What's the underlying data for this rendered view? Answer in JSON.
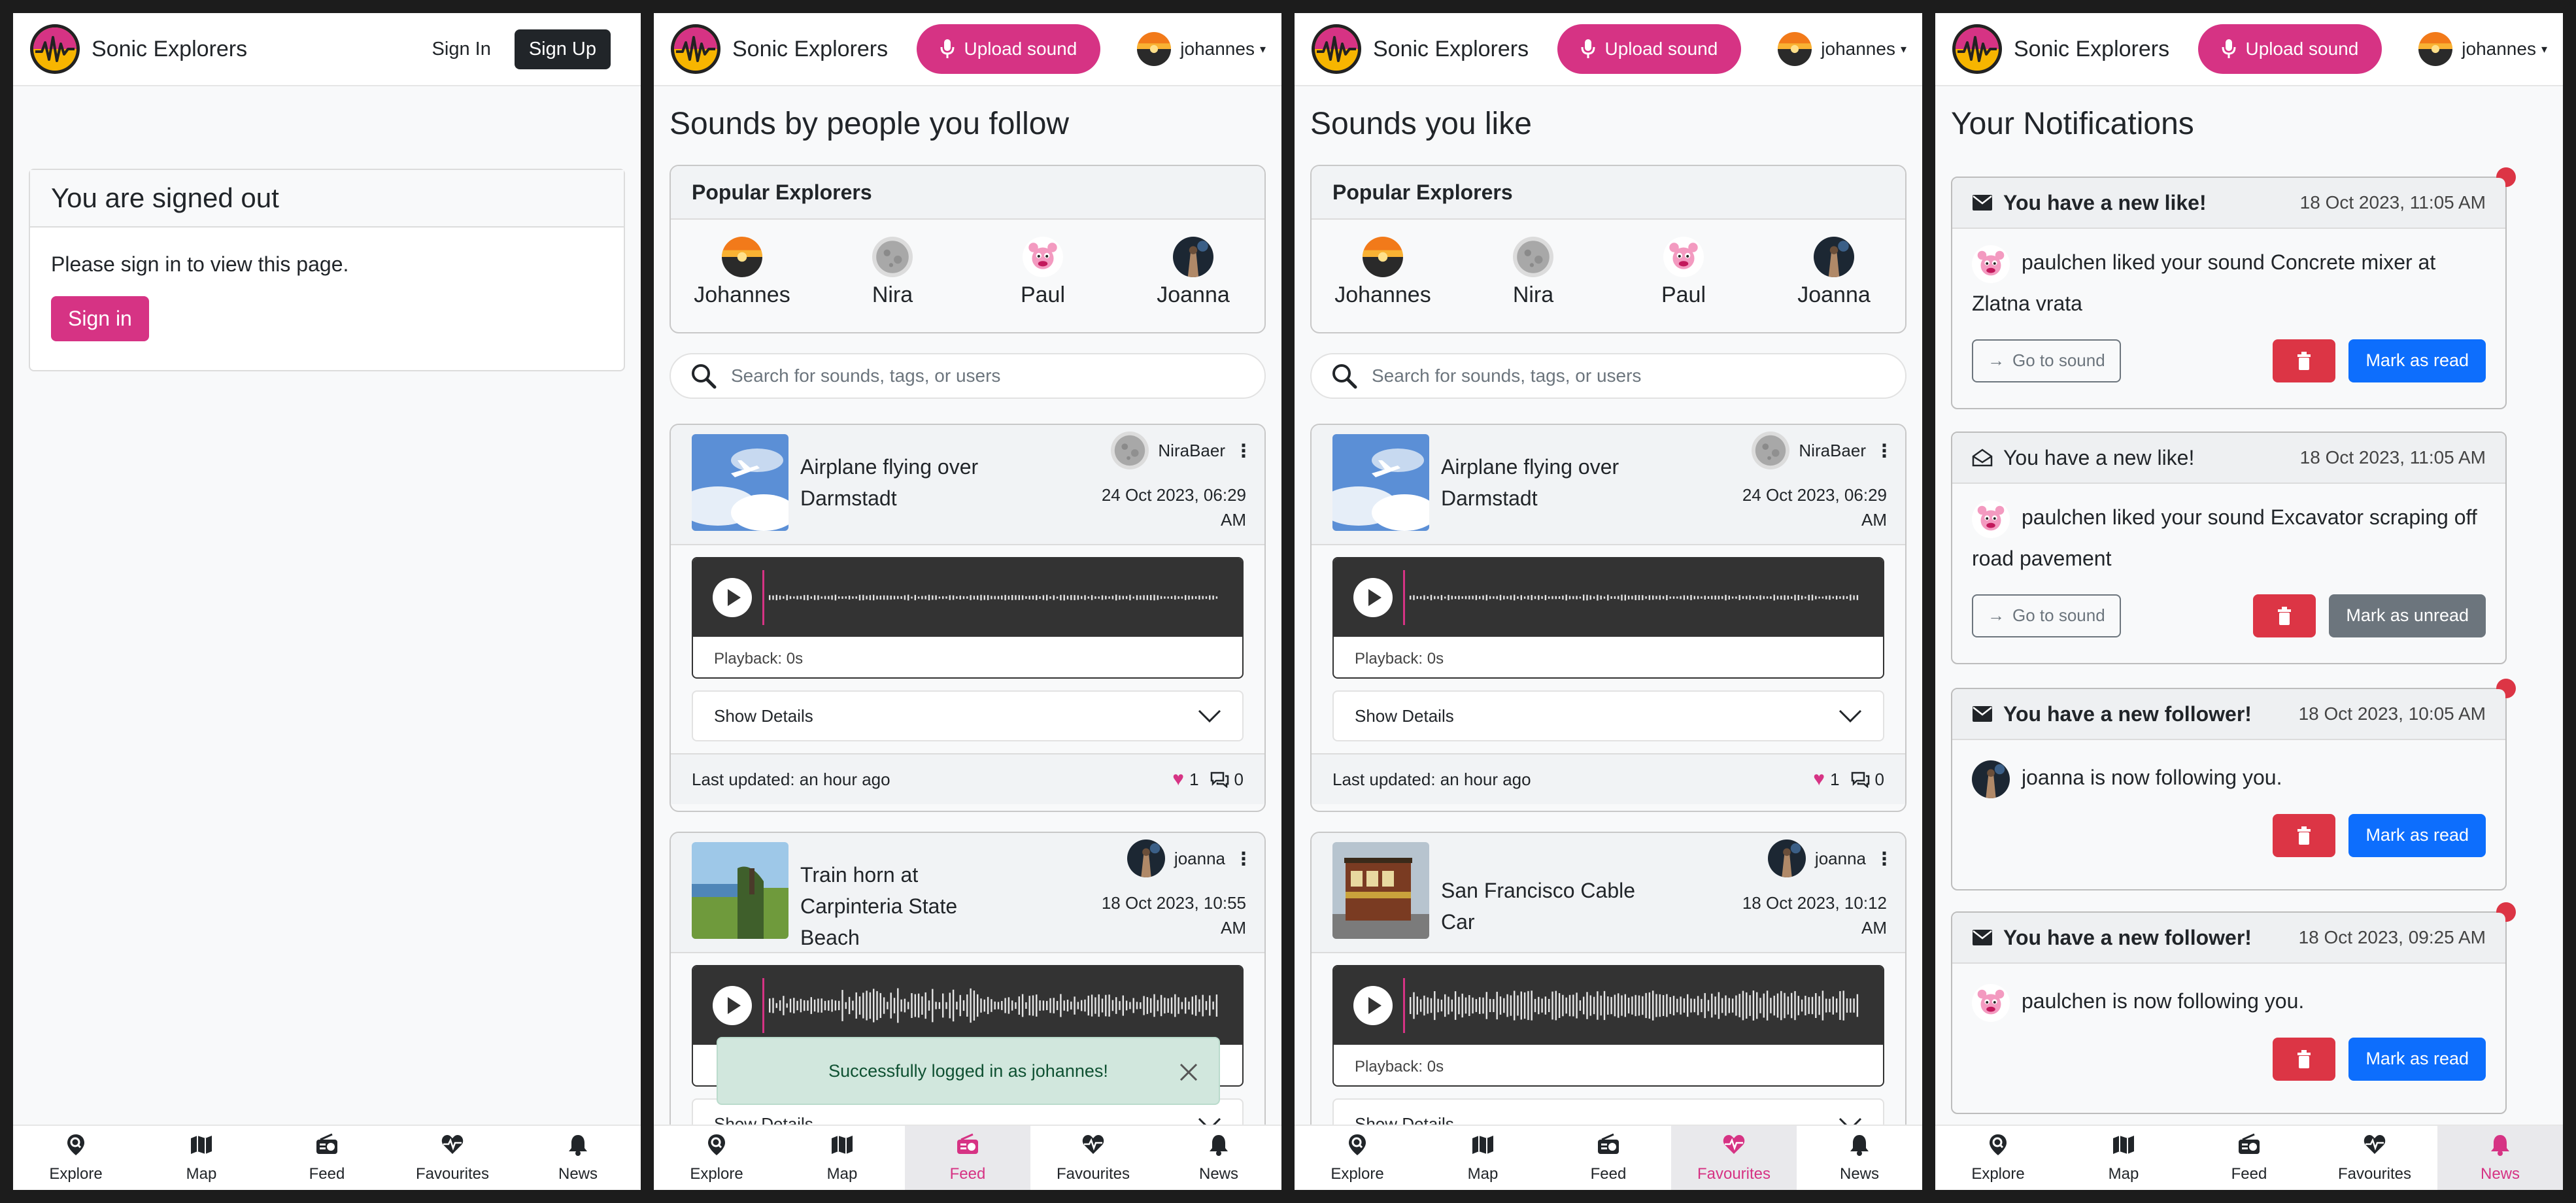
{
  "app": {
    "brand": "Sonic Explorers",
    "accent_color": "#d63384",
    "upload_label": "Upload sound",
    "username": "johannes",
    "sign_in_label": "Sign In",
    "sign_up_label": "Sign Up"
  },
  "nav": {
    "items": [
      {
        "label": "Explore",
        "icon": "search-pin-icon"
      },
      {
        "label": "Map",
        "icon": "map-icon"
      },
      {
        "label": "Feed",
        "icon": "radio-icon"
      },
      {
        "label": "Favourites",
        "icon": "heart-pulse-icon"
      },
      {
        "label": "News",
        "icon": "bell-icon"
      }
    ]
  },
  "signed_out": {
    "title": "You are signed out",
    "message": "Please sign in to view this page.",
    "button": "Sign in"
  },
  "popular": {
    "title": "Popular Explorers",
    "explorers": [
      "Johannes",
      "Nira",
      "Paul",
      "Joanna"
    ]
  },
  "search": {
    "placeholder": "Search for sounds, tags, or users"
  },
  "feed": {
    "title": "Sounds by people you follow",
    "sounds": [
      {
        "title": "Airplane flying over Darmstadt",
        "owner": "NiraBaer",
        "date_line1": "24 Oct 2023, 06:29",
        "date_line2": "AM",
        "playback": "Playback: 0s",
        "details": "Show Details",
        "updated": "Last updated: an hour ago",
        "likes": "1",
        "comments": "0"
      },
      {
        "title": "Train horn at Carpinteria State Beach",
        "owner": "joanna",
        "date_line1": "18 Oct 2023, 10:55",
        "date_line2": "AM",
        "details": "Show Details"
      }
    ],
    "toast": "Successfully logged in as johannes!"
  },
  "favourites": {
    "title": "Sounds you like",
    "sounds": [
      {
        "title": "Airplane flying over Darmstadt",
        "owner": "NiraBaer",
        "date_line1": "24 Oct 2023, 06:29",
        "date_line2": "AM",
        "playback": "Playback: 0s",
        "details": "Show Details",
        "updated": "Last updated: an hour ago",
        "likes": "1",
        "comments": "0"
      },
      {
        "title": "San Francisco Cable Car",
        "owner": "joanna",
        "date_line1": "18 Oct 2023, 10:12",
        "date_line2": "AM",
        "playback": "Playback: 0s",
        "details": "Show Details"
      }
    ]
  },
  "notifications": {
    "title": "Your Notifications",
    "goto_label": "Go to sound",
    "items": [
      {
        "title": "You have a new like!",
        "date": "18 Oct 2023, 11:05 AM",
        "text": "paulchen liked your sound Concrete mixer at Zlatna vrata",
        "action": "Mark as read"
      },
      {
        "title": "You have a new like!",
        "date": "18 Oct 2023, 11:05 AM",
        "text": "paulchen liked your sound Excavator scraping off road pavement",
        "action": "Mark as unread"
      },
      {
        "title": "You have a new follower!",
        "date": "18 Oct 2023, 10:05 AM",
        "text": "joanna is now following you.",
        "action": "Mark as read"
      },
      {
        "title": "You have a new follower!",
        "date": "18 Oct 2023, 09:25 AM",
        "text": "paulchen is now following you.",
        "action": "Mark as read"
      }
    ]
  }
}
